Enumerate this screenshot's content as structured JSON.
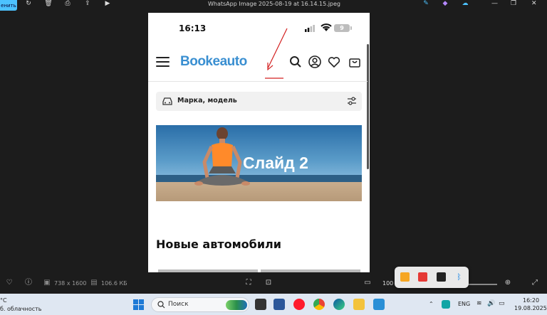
{
  "window": {
    "title": "WhatsApp Image 2025-08-19 at 16.14.15.jpeg",
    "edit_label": "енить"
  },
  "phone": {
    "status_time": "16:13",
    "battery": "9",
    "logo": "Bookeauto",
    "search_placeholder": "Марка, модель",
    "slide_text": "Слайд 2",
    "section_title": "Новые автомобили"
  },
  "bottombar": {
    "dimensions": "738 x 1600",
    "file_size": "106.6 КБ",
    "zoom": "100"
  },
  "taskbar": {
    "weather_temp": "°C",
    "weather_desc": "б. облачность",
    "search_label": "Поиск",
    "language": "ENG",
    "time": "16:20",
    "date": "19.08.2025"
  },
  "colors": {
    "logo": "#3a8fd1",
    "accent": "#4cc2ff",
    "annotation": "#d32020"
  }
}
